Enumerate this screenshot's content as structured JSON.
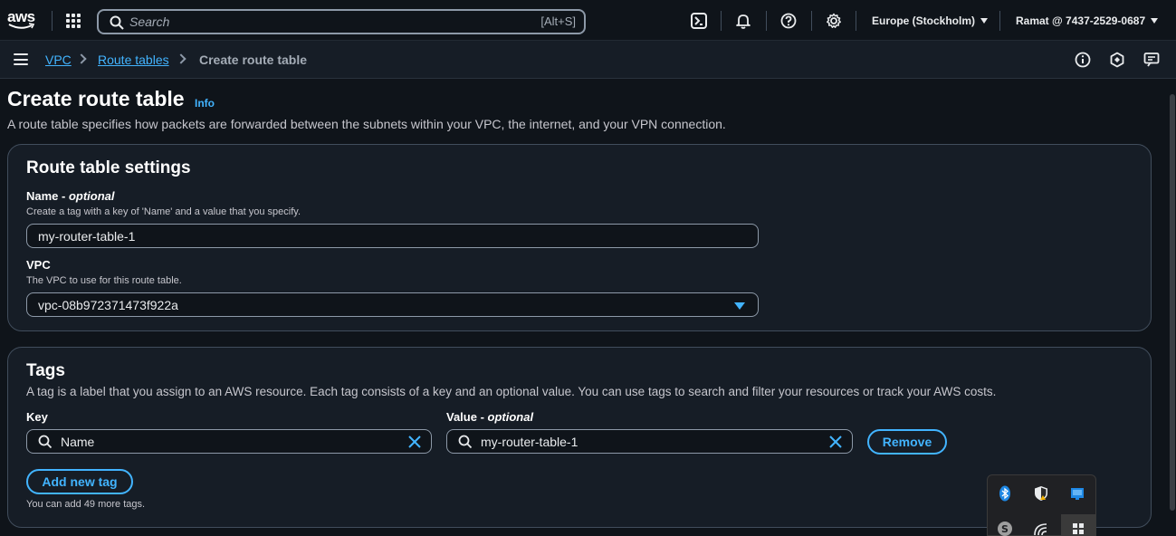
{
  "topnav": {
    "logo": "aws",
    "search_placeholder": "Search",
    "search_shortcut": "[Alt+S]",
    "region": "Europe (Stockholm)",
    "account": "Ramat @ 7437-2529-0687"
  },
  "breadcrumb": {
    "items": [
      {
        "label": "VPC"
      },
      {
        "label": "Route tables"
      },
      {
        "label": "Create route table"
      }
    ]
  },
  "page": {
    "title": "Create route table",
    "info": "Info",
    "description": "A route table specifies how packets are forwarded between the subnets within your VPC, the internet, and your VPN connection."
  },
  "settings": {
    "heading": "Route table settings",
    "name_label": "Name - ",
    "name_optional": "optional",
    "name_hint": "Create a tag with a key of 'Name' and a value that you specify.",
    "name_value": "my-router-table-1",
    "vpc_label": "VPC",
    "vpc_hint": "The VPC to use for this route table.",
    "vpc_value": "vpc-08b972371473f922a"
  },
  "tags": {
    "heading": "Tags",
    "description": "A tag is a label that you assign to an AWS resource. Each tag consists of a key and an optional value. You can use tags to search and filter your resources or track your AWS costs.",
    "key_label": "Key",
    "value_label": "Value - ",
    "value_optional": "optional",
    "key_value": "Name",
    "value_value": "my-router-table-1",
    "remove_label": "Remove",
    "add_label": "Add new tag",
    "remaining_hint": "You can add 49 more tags."
  },
  "colors": {
    "background": "#0f141a",
    "card": "#161d26",
    "accent": "#42b4ff",
    "border": "#414d5c"
  }
}
